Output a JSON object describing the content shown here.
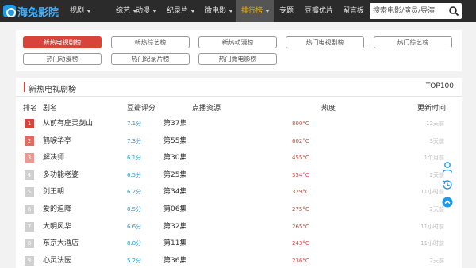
{
  "nav": {
    "logo_text": "海兔影院",
    "items": [
      {
        "label": "视剧"
      },
      {
        "label": "综艺"
      },
      {
        "label": "动漫"
      },
      {
        "label": "纪录片"
      },
      {
        "label": "微电影"
      },
      {
        "label": "排行榜"
      },
      {
        "label": "专题"
      },
      {
        "label": "豆瓣优片"
      },
      {
        "label": "留言板"
      }
    ],
    "search_placeholder": "搜索电影/演员/导演"
  },
  "categories": [
    {
      "label": "新热电视剧榜"
    },
    {
      "label": "新热综艺榜"
    },
    {
      "label": "新热动漫榜"
    },
    {
      "label": "热门电视剧榜"
    },
    {
      "label": "热门综艺榜"
    },
    {
      "label": "热门动漫榜"
    },
    {
      "label": "热门纪录片榜"
    },
    {
      "label": "热门微电影榜"
    }
  ],
  "ranking": {
    "title": "新热电视剧榜",
    "top_label": "TOP100",
    "headers": {
      "rank": "排名",
      "name": "剧名",
      "score": "豆瓣评分",
      "source": "点播资源",
      "heat": "热度",
      "updated": "更新时间"
    },
    "rows": [
      {
        "rank": "1",
        "name": "从前有座灵剑山",
        "score": "7.1分",
        "episode": "第37集",
        "heat": "800°C",
        "updated": "12天前"
      },
      {
        "rank": "2",
        "name": "鹤唳华亭",
        "score": "7.3分",
        "episode": "第55集",
        "heat": "602°C",
        "updated": "3天前"
      },
      {
        "rank": "3",
        "name": "解决师",
        "score": "6.1分",
        "episode": "第30集",
        "heat": "455°C",
        "updated": "1个月前"
      },
      {
        "rank": "4",
        "name": "多功能老婆",
        "score": "6.5分",
        "episode": "第25集",
        "heat": "354°C",
        "updated": "2天前"
      },
      {
        "rank": "5",
        "name": "剑王朝",
        "score": "6.2分",
        "episode": "第34集",
        "heat": "329°C",
        "updated": "11小时前"
      },
      {
        "rank": "6",
        "name": "爱的迫降",
        "score": "8.5分",
        "episode": "第06集",
        "heat": "275°C",
        "updated": "2天前"
      },
      {
        "rank": "7",
        "name": "大明风华",
        "score": "6.6分",
        "episode": "第32集",
        "heat": "265°C",
        "updated": "11小时前"
      },
      {
        "rank": "8",
        "name": "东京大酒店",
        "score": "8.8分",
        "episode": "第11集",
        "heat": "243°C",
        "updated": "11小时前"
      },
      {
        "rank": "9",
        "name": "心灵法医",
        "score": "5.2分",
        "episode": "第36集",
        "heat": "236°C",
        "updated": "2天前"
      }
    ]
  },
  "colors": {
    "accent_red": "#d9443a",
    "link_blue": "#1e9be8",
    "rank_top3": [
      "#d9443a",
      "#e26a5e",
      "#ec9a91"
    ],
    "rank_other": "#d0d0d0",
    "nav_active_text": "#f0b400"
  },
  "side_tools": [
    "user-icon",
    "history-icon",
    "back-to-top-icon"
  ]
}
